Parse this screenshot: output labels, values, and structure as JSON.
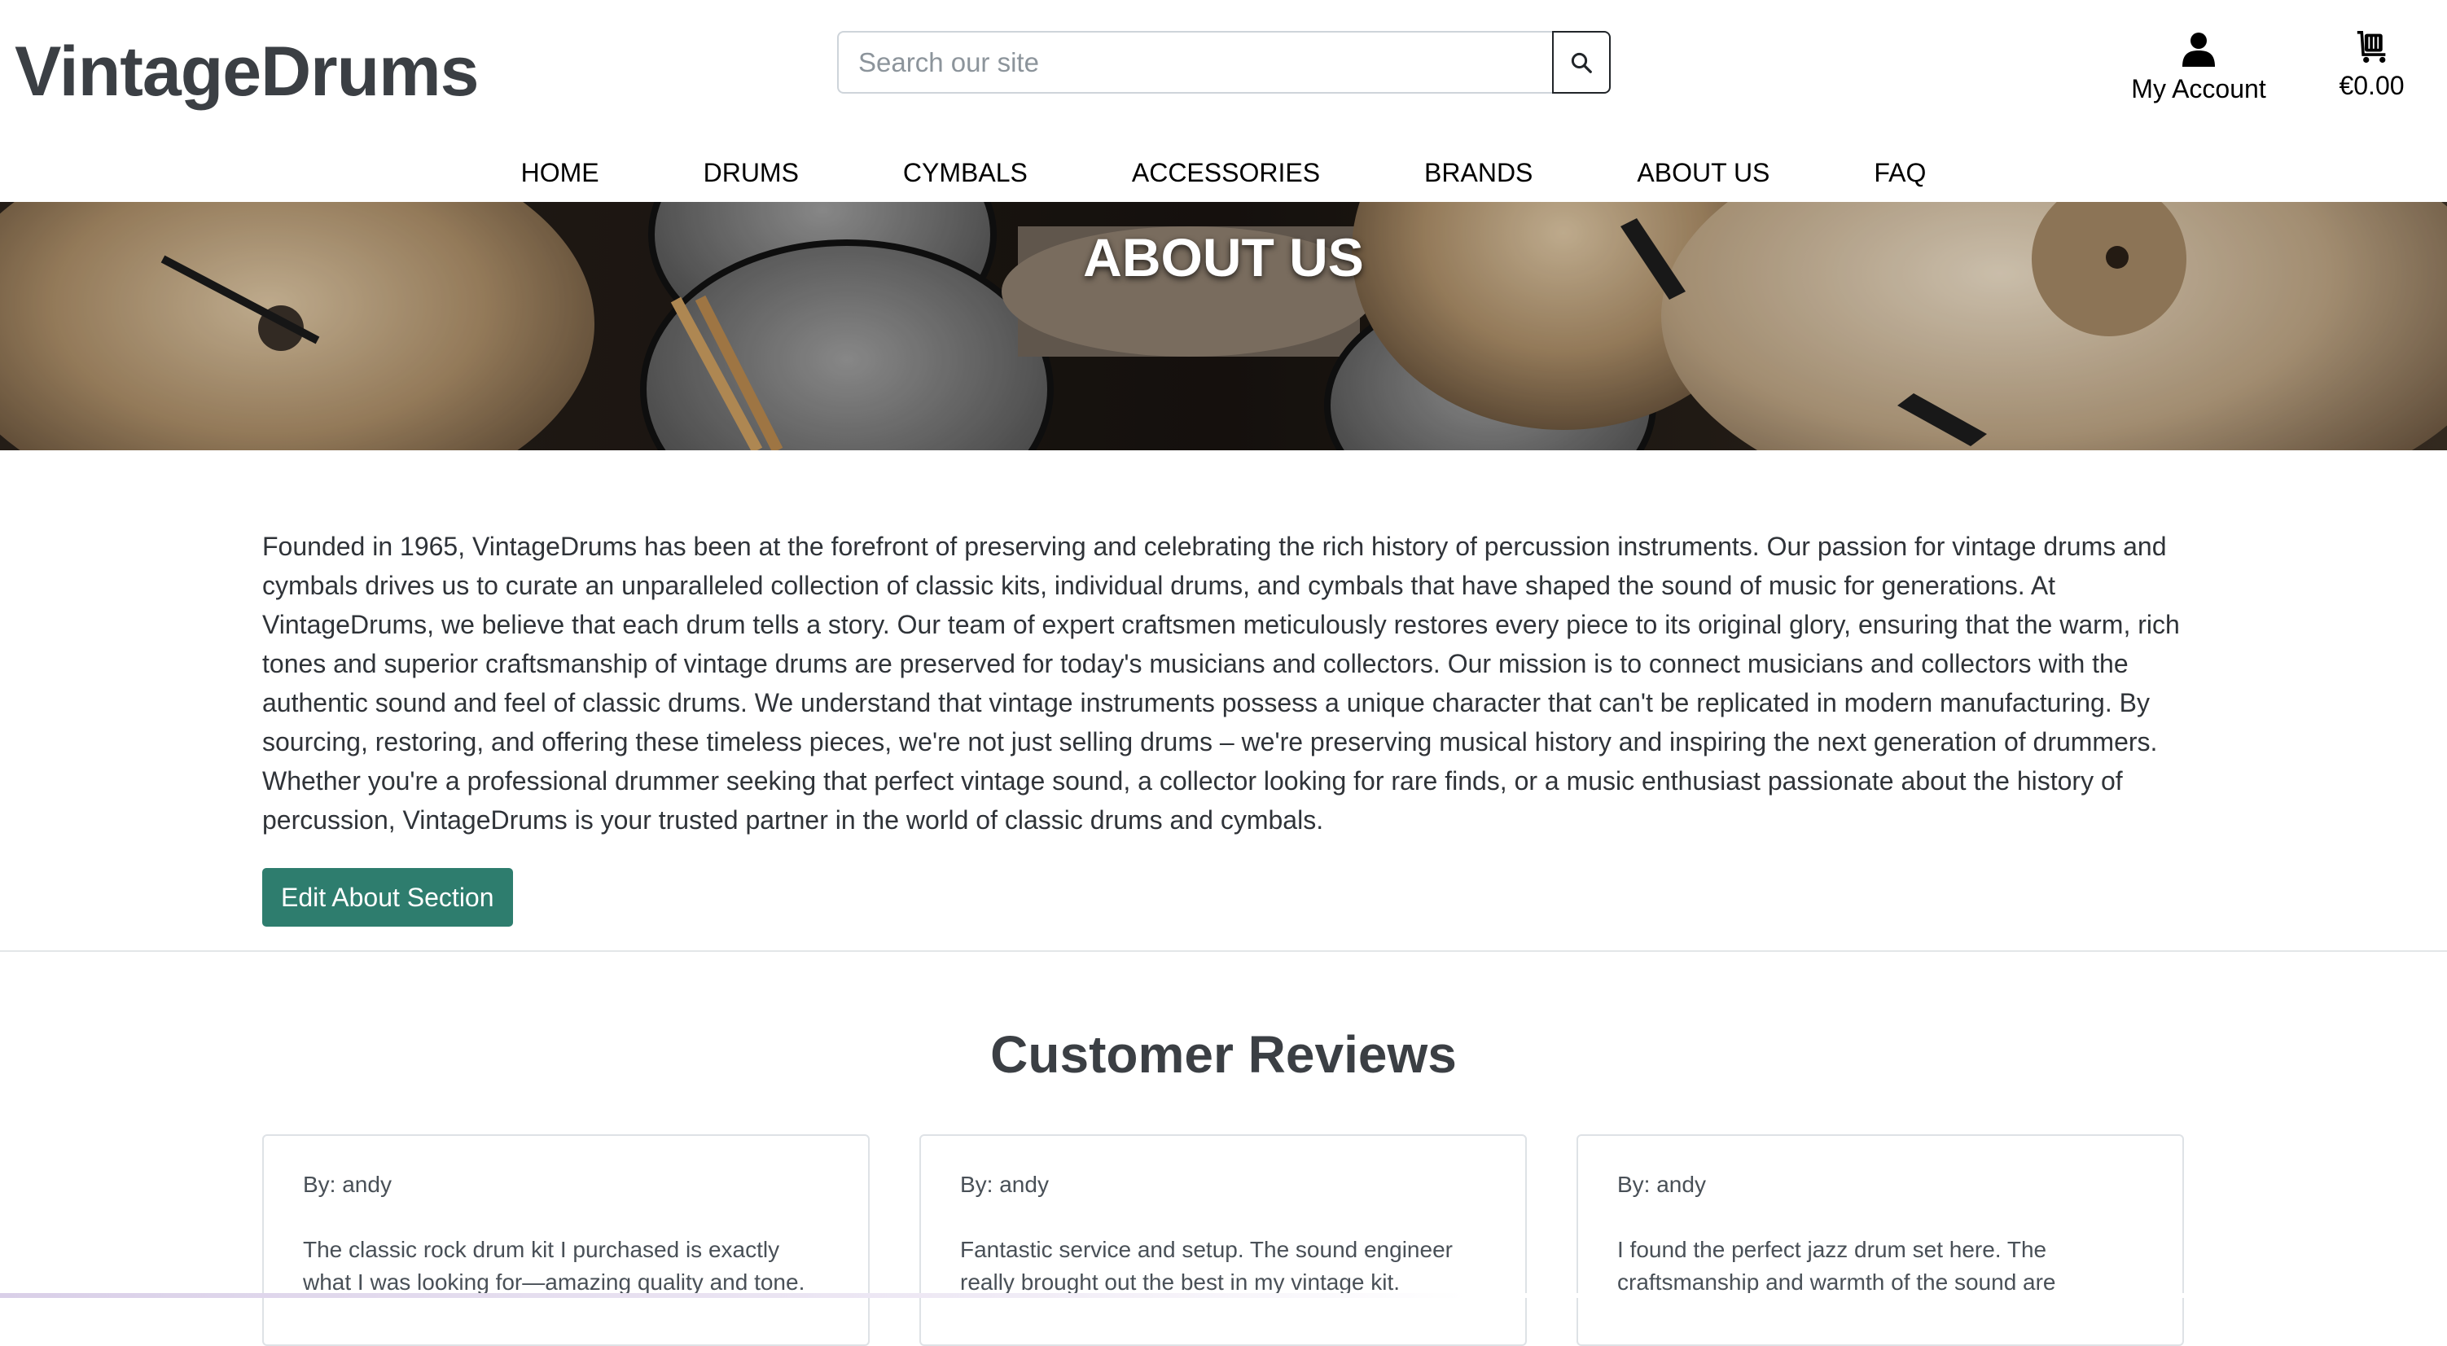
{
  "site": {
    "logo": "VintageDrums"
  },
  "search": {
    "placeholder": "Search our site"
  },
  "account": {
    "label": "My Account"
  },
  "cart": {
    "total": "€0.00"
  },
  "nav": {
    "items": [
      "HOME",
      "DRUMS",
      "CYMBALS",
      "ACCESSORIES",
      "BRANDS",
      "ABOUT US",
      "FAQ"
    ]
  },
  "hero": {
    "title": "ABOUT US"
  },
  "about": {
    "body": "Founded in 1965, VintageDrums has been at the forefront of preserving and celebrating the rich history of percussion instruments. Our passion for vintage drums and cymbals drives us to curate an unparalleled collection of classic kits, individual drums, and cymbals that have shaped the sound of music for generations. At VintageDrums, we believe that each drum tells a story. Our team of expert craftsmen meticulously restores every piece to its original glory, ensuring that the warm, rich tones and superior craftsmanship of vintage drums are preserved for today's musicians and collectors. Our mission is to connect musicians and collectors with the authentic sound and feel of classic drums. We understand that vintage instruments possess a unique character that can't be replicated in modern manufacturing. By sourcing, restoring, and offering these timeless pieces, we're not just selling drums – we're preserving musical history and inspiring the next generation of drummers. Whether you're a professional drummer seeking that perfect vintage sound, a collector looking for rare finds, or a music enthusiast passionate about the history of percussion, VintageDrums is your trusted partner in the world of classic drums and cymbals.",
    "edit_button": "Edit About Section"
  },
  "reviews": {
    "title": "Customer Reviews",
    "items": [
      {
        "author": "By: andy",
        "text": "The classic rock drum kit I purchased is exactly what I was looking for—amazing quality and tone."
      },
      {
        "author": "By: andy",
        "text": "Fantastic service and setup. The sound engineer really brought out the best in my vintage kit."
      },
      {
        "author": "By: andy",
        "text": "I found the perfect jazz drum set here. The craftsmanship and warmth of the sound are"
      }
    ]
  },
  "colors": {
    "brand_text": "#3b3f44",
    "edit_button": "#2e7d6e",
    "hero_dark": "#1d1a17",
    "cymbal_bronze": "#b39a78"
  },
  "icons": {
    "search": "search-icon",
    "account": "user-icon",
    "cart": "cart-icon"
  }
}
